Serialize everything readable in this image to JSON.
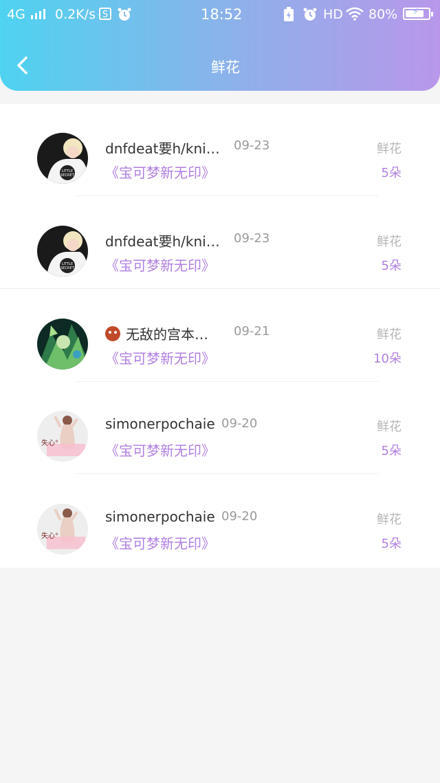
{
  "status_bar": {
    "network": "4G",
    "speed": "0.2K/s",
    "s_icon": "S",
    "time": "18:52",
    "hd": "HD",
    "battery": "80%",
    "battery_level": 0.8
  },
  "header": {
    "title": "鲜花",
    "back_icon": "chevron-left-icon"
  },
  "colors": {
    "header_gradient_start": "#4ed3f0",
    "header_gradient_end": "#b897ea",
    "accent_purple": "#b07fe0"
  },
  "records": [
    {
      "username": "dnfdeat要h/kni…",
      "date": "09-23",
      "gift_name": "《宝可梦新无印》",
      "gift_type": "鲜花",
      "gift_count": "5朵",
      "avatar": "avatar-white-shirt"
    },
    {
      "username": "dnfdeat要h/kni…",
      "date": "09-23",
      "gift_name": "《宝可梦新无印》",
      "gift_type": "鲜花",
      "gift_count": "5朵",
      "avatar": "avatar-white-shirt"
    },
    {
      "username": "无敌的宫本…",
      "date": "09-21",
      "gift_name": "《宝可梦新无印》",
      "gift_type": "鲜花",
      "gift_count": "10朵",
      "avatar": "avatar-green-art",
      "emoji": "ogre-emoji"
    },
    {
      "username": "simonerpochaie",
      "date": "09-20",
      "gift_name": "《宝可梦新无印》",
      "gift_type": "鲜花",
      "gift_count": "5朵",
      "avatar": "avatar-figure-pink",
      "avatar_text": "失心°"
    },
    {
      "username": "simonerpochaie",
      "date": "09-20",
      "gift_name": "《宝可梦新无印》",
      "gift_type": "鲜花",
      "gift_count": "5朵",
      "avatar": "avatar-figure-pink",
      "avatar_text": "失心°"
    }
  ]
}
